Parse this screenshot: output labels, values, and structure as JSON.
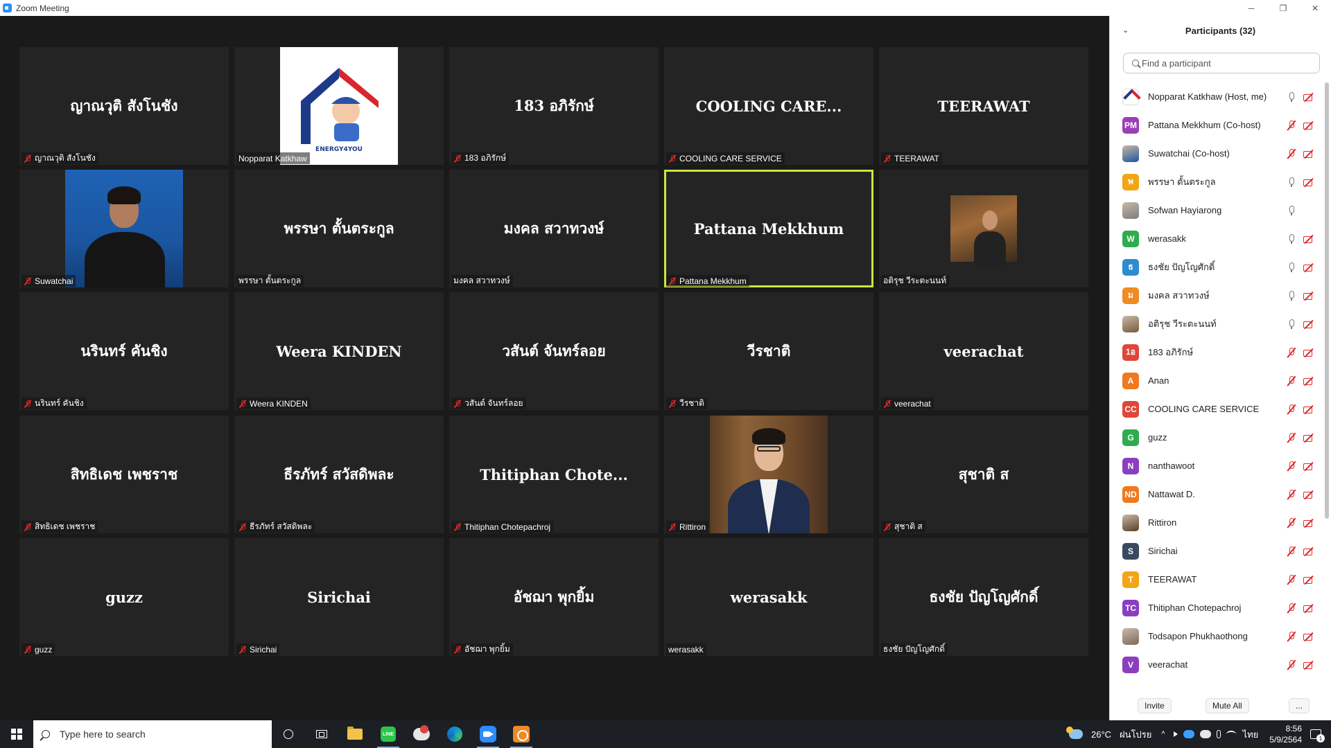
{
  "window": {
    "title": "Zoom Meeting",
    "minimize": "─",
    "restore": "❐",
    "close": "✕"
  },
  "gallery": [
    {
      "center": "ญาณวุติ  สังโนชัง",
      "label": "ญาณวุติ  สังโนชัง",
      "muted": true,
      "media": "none"
    },
    {
      "center": "",
      "label": "Nopparat Katkhaw",
      "muted": false,
      "media": "logo"
    },
    {
      "center": "183 อภิรักษ์",
      "label": "183 อภิรักษ์",
      "muted": true,
      "media": "none"
    },
    {
      "center": "COOLING  CARE...",
      "label": "COOLING CARE SERVICE",
      "muted": true,
      "media": "none"
    },
    {
      "center": "TEERAWAT",
      "label": "TEERAWAT",
      "muted": true,
      "media": "none"
    },
    {
      "center": "",
      "label": "Suwatchai",
      "muted": true,
      "media": "person"
    },
    {
      "center": "พรรษา ตั้นตระกูล",
      "label": "พรรษา ตั้นตระกูล",
      "muted": false,
      "media": "none"
    },
    {
      "center": "มงคล สวาทวงษ์",
      "label": "มงคล สวาทวงษ์",
      "muted": false,
      "media": "none"
    },
    {
      "center": "Pattana Mekkhum",
      "label": "Pattana Mekkhum",
      "muted": true,
      "media": "none",
      "active": true
    },
    {
      "center": "",
      "label": "อติรุช วีระตะนนท์",
      "muted": false,
      "media": "small"
    },
    {
      "center": "นรินทร์ คันชิง",
      "label": "นรินทร์ คันชิง",
      "muted": true,
      "media": "none"
    },
    {
      "center": "Weera KINDEN",
      "label": "Weera KINDEN",
      "muted": true,
      "media": "none"
    },
    {
      "center": "วสันต์ จันทร์ลอย",
      "label": "วสันต์ จันทร์ลอย",
      "muted": true,
      "media": "none"
    },
    {
      "center": "วีรชาติ",
      "label": "วีรชาติ",
      "muted": true,
      "media": "none"
    },
    {
      "center": "veerachat",
      "label": "veerachat",
      "muted": true,
      "media": "none"
    },
    {
      "center": "สิทธิเดช เพชราช",
      "label": "สิทธิเดช เพชราช",
      "muted": true,
      "media": "none"
    },
    {
      "center": "ธีรภัทร์ สวัสดิพละ",
      "label": "ธีรภัทร์ สวัสดิพละ",
      "muted": true,
      "media": "none"
    },
    {
      "center": "Thitiphan   Chote...",
      "label": "Thitiphan  Chotepachroj",
      "muted": true,
      "media": "none"
    },
    {
      "center": "",
      "label": "Rittiron",
      "muted": true,
      "media": "suit"
    },
    {
      "center": "สุชาติ  ส",
      "label": "สุชาติ  ส",
      "muted": true,
      "media": "none"
    },
    {
      "center": "guzz",
      "label": "guzz",
      "muted": true,
      "media": "none"
    },
    {
      "center": "Sirichai",
      "label": "Sirichai",
      "muted": true,
      "media": "none"
    },
    {
      "center": "อัชฌา พุกยิ้ม",
      "label": "อัชฌา พุกยิ้ม",
      "muted": true,
      "media": "none"
    },
    {
      "center": "werasakk",
      "label": "werasakk",
      "muted": false,
      "media": "none"
    },
    {
      "center": "ธงชัย ปัญโญศักดิ์",
      "label": "ธงชัย ปัญโญศักดิ์",
      "muted": false,
      "media": "none"
    }
  ],
  "logo_text": "ENERGY4YOU",
  "participants": {
    "title": "Participants (32)",
    "collapse_icon": "⌄",
    "search_placeholder": "Find a participant",
    "items": [
      {
        "name": "Nopparat Katkhaw (Host, me)",
        "avatar": "",
        "avatar_type": "logo",
        "color": "#ffffff",
        "mic": "on",
        "cam": "off"
      },
      {
        "name": "Pattana Mekkhum (Co-host)",
        "avatar": "PM",
        "avatar_type": "text",
        "color": "#9b3fb5",
        "mic": "off",
        "cam": "off"
      },
      {
        "name": "Suwatchai (Co-host)",
        "avatar": "",
        "avatar_type": "img",
        "color": "#1b56a0",
        "mic": "off",
        "cam": "off"
      },
      {
        "name": "พรรษา ตั้นตระกูล",
        "avatar": "พ",
        "avatar_type": "text",
        "color": "#f2a516",
        "mic": "on",
        "cam": "off"
      },
      {
        "name": "Sofwan Hayiarong",
        "avatar": "",
        "avatar_type": "img",
        "color": "#7d7d7d",
        "mic": "on",
        "cam": "none"
      },
      {
        "name": "werasakk",
        "avatar": "W",
        "avatar_type": "text",
        "color": "#2eac4e",
        "mic": "on",
        "cam": "off"
      },
      {
        "name": "ธงชัย ปัญโญศักดิ์",
        "avatar": "ธ",
        "avatar_type": "text",
        "color": "#2d8ccf",
        "mic": "on",
        "cam": "off"
      },
      {
        "name": "มงคล สวาทวงษ์",
        "avatar": "ม",
        "avatar_type": "text",
        "color": "#f08a24",
        "mic": "on",
        "cam": "off"
      },
      {
        "name": "อติรุช วีระตะนนท์",
        "avatar": "",
        "avatar_type": "img",
        "color": "#7a5a3a",
        "mic": "on",
        "cam": "off"
      },
      {
        "name": "183 อภิรักษ์",
        "avatar": "1อ",
        "avatar_type": "text",
        "color": "#e0463a",
        "mic": "off",
        "cam": "off"
      },
      {
        "name": "Anan",
        "avatar": "A",
        "avatar_type": "text",
        "color": "#f0781e",
        "mic": "off",
        "cam": "off"
      },
      {
        "name": "COOLING CARE SERVICE",
        "avatar": "CC",
        "avatar_type": "text",
        "color": "#e0463a",
        "mic": "off",
        "cam": "off"
      },
      {
        "name": "guzz",
        "avatar": "G",
        "avatar_type": "text",
        "color": "#2eac4e",
        "mic": "off",
        "cam": "off"
      },
      {
        "name": "nanthawoot",
        "avatar": "N",
        "avatar_type": "text",
        "color": "#8a3fc0",
        "mic": "off",
        "cam": "off"
      },
      {
        "name": "Nattawat D.",
        "avatar": "ND",
        "avatar_type": "text",
        "color": "#f0781e",
        "mic": "off",
        "cam": "off"
      },
      {
        "name": "Rittiron",
        "avatar": "",
        "avatar_type": "img",
        "color": "#5a3d22",
        "mic": "off",
        "cam": "off"
      },
      {
        "name": "Sirichai",
        "avatar": "S",
        "avatar_type": "text",
        "color": "#3a4a5e",
        "mic": "off",
        "cam": "off"
      },
      {
        "name": "TEERAWAT",
        "avatar": "T",
        "avatar_type": "text",
        "color": "#f2a516",
        "mic": "off",
        "cam": "off"
      },
      {
        "name": "Thitiphan  Chotepachroj",
        "avatar": "TC",
        "avatar_type": "text",
        "color": "#8a3fc0",
        "mic": "off",
        "cam": "off"
      },
      {
        "name": "Todsapon Phukhaothong",
        "avatar": "",
        "avatar_type": "img",
        "color": "#7d6a5a",
        "mic": "off",
        "cam": "off"
      },
      {
        "name": "veerachat",
        "avatar": "V",
        "avatar_type": "text",
        "color": "#8a3fc0",
        "mic": "off",
        "cam": "off"
      }
    ],
    "invite_label": "Invite",
    "mute_all_label": "Mute All",
    "more_label": "..."
  },
  "taskbar": {
    "search_placeholder": "Type here to search",
    "temperature": "26°C",
    "weather_text": "ฝนโปรย",
    "chevron": "^",
    "lang": "ไทย",
    "time": "8:56",
    "date": "5/9/2564",
    "notification_count": "1"
  },
  "colors": {
    "active_speaker_border": "#cde43c",
    "muted_red": "#e02828",
    "zoom_blue": "#2d8cff"
  }
}
